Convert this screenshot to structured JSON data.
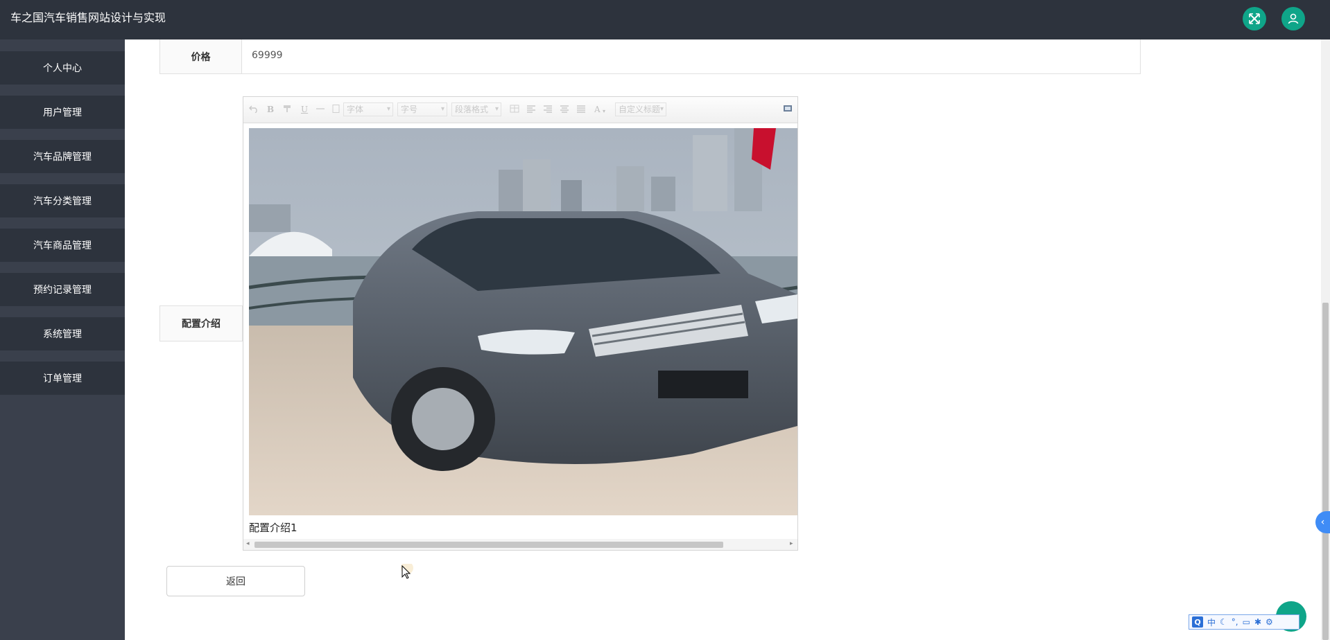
{
  "app": {
    "title": "车之国汽车销售网站设计与实现"
  },
  "header": {
    "icons": [
      "fullscreen-icon",
      "user-icon"
    ],
    "accent_color": "#0fa589"
  },
  "sidebar": {
    "items": [
      {
        "label": "个人中心"
      },
      {
        "label": "用户管理"
      },
      {
        "label": "汽车品牌管理"
      },
      {
        "label": "汽车分类管理"
      },
      {
        "label": "汽车商品管理"
      },
      {
        "label": "预约记录管理"
      },
      {
        "label": "系统管理"
      },
      {
        "label": "订单管理"
      }
    ]
  },
  "form": {
    "price": {
      "label": "价格",
      "value": "69999"
    },
    "config": {
      "label": "配置介绍"
    }
  },
  "editor": {
    "toolbar": {
      "font_family": "字体",
      "font_size": "字号",
      "paragraph_format": "段落格式",
      "custom_title": "自定义标题",
      "bold": "B",
      "underline": "U",
      "font_color": "A"
    },
    "caption": "配置介绍1"
  },
  "actions": {
    "back_label": "返回"
  },
  "ime": {
    "logo": "Q",
    "mode": "中"
  }
}
